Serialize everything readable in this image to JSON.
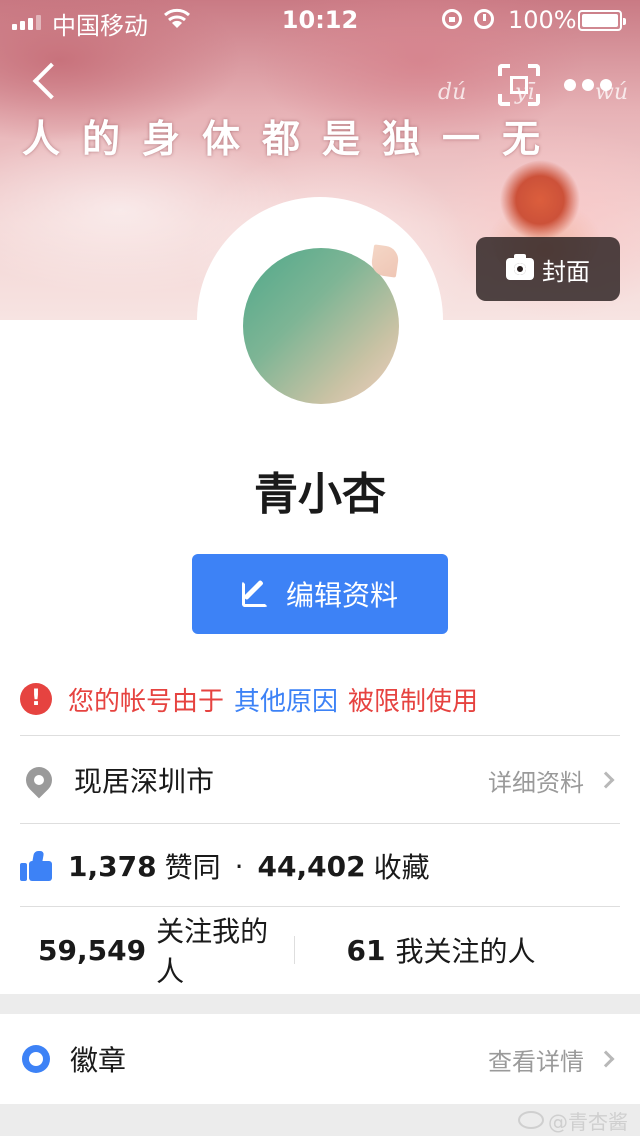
{
  "status_bar": {
    "carrier": "中国移动",
    "time": "10:12",
    "battery": "100%"
  },
  "cover": {
    "text": "人的身体都是独一无",
    "pinyin": [
      "dú",
      "yī",
      "wú"
    ],
    "cover_button_label": "封面"
  },
  "profile": {
    "username": "青小杏",
    "edit_button_label": "编辑资料"
  },
  "warning": {
    "part1": "您的帐号由于",
    "part2": "其他原因",
    "part3": "被限制使用"
  },
  "location": {
    "text": "现居深圳市",
    "detail_link": "详细资料"
  },
  "stats": {
    "likes_count": "1,378",
    "likes_label": "赞同",
    "separator": "·",
    "favorites_count": "44,402",
    "favorites_label": "收藏"
  },
  "follow": {
    "followers_count": "59,549",
    "followers_label": "关注我的人",
    "following_count": "61",
    "following_label": "我关注的人"
  },
  "badges": {
    "label": "徽章",
    "detail_link": "查看详情"
  },
  "watermark": {
    "text": "@青杏酱"
  },
  "colors": {
    "accent_blue": "#3d82f6",
    "warning_red": "#e64340"
  }
}
